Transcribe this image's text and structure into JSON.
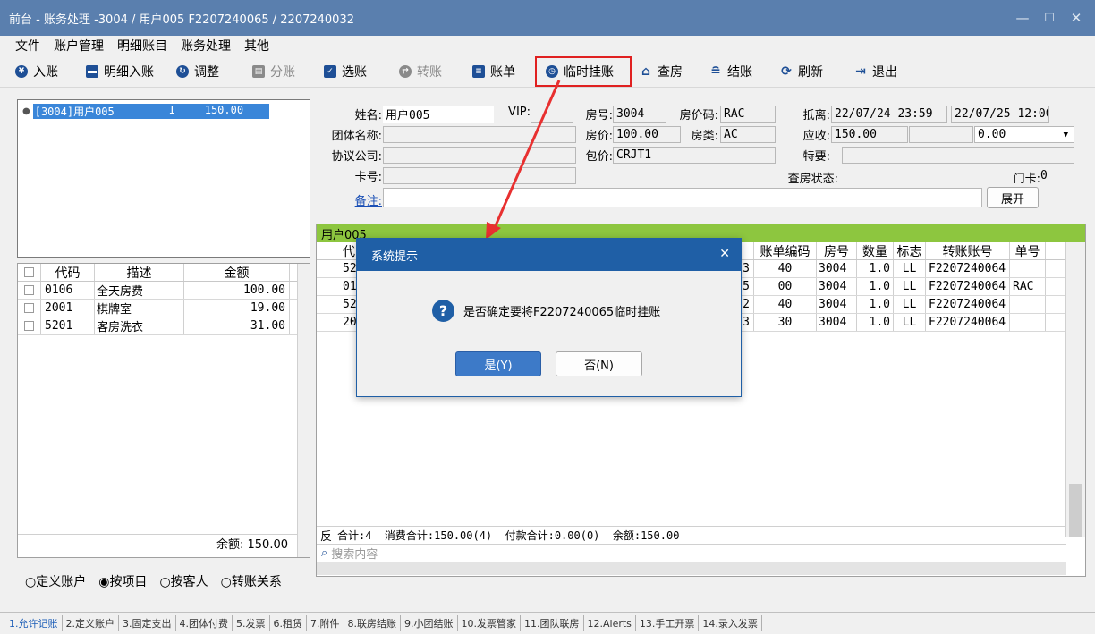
{
  "window": {
    "title": "前台 - 账务处理 -3004 / 用户005 F2207240065 / 2207240032",
    "minimize": "—",
    "maximize": "☐",
    "close": "✕"
  },
  "menu": [
    "文件",
    "账户管理",
    "明细账目",
    "账务处理",
    "其他"
  ],
  "toolbar": [
    {
      "label": "入账",
      "icon": "yen-icon",
      "enabled": true
    },
    {
      "label": "明细入账",
      "icon": "card-icon",
      "enabled": true
    },
    {
      "label": "调整",
      "icon": "adjust-icon",
      "enabled": true
    },
    {
      "label": "分账",
      "icon": "split-icon",
      "enabled": false
    },
    {
      "label": "选账",
      "icon": "select-icon",
      "enabled": true
    },
    {
      "label": "转账",
      "icon": "transfer-icon",
      "enabled": false
    },
    {
      "label": "账单",
      "icon": "bill-icon",
      "enabled": true
    },
    {
      "label": "临时挂账",
      "icon": "clock-icon",
      "enabled": true
    },
    {
      "label": "查房",
      "icon": "house-icon",
      "enabled": true
    },
    {
      "label": "结账",
      "icon": "database-icon",
      "enabled": true
    },
    {
      "label": "刷新",
      "icon": "refresh-icon",
      "enabled": true
    },
    {
      "label": "退出",
      "icon": "exit-icon",
      "enabled": true
    }
  ],
  "account_list": {
    "bullet": "●",
    "items": [
      {
        "room": "[3004]用户005",
        "status": "I",
        "amount": "150.00"
      }
    ]
  },
  "left_grid": {
    "headers": [
      "代码",
      "描述",
      "金额"
    ],
    "rows": [
      [
        "0106",
        "全天房费",
        "100.00"
      ],
      [
        "2001",
        "棋牌室",
        "19.00"
      ],
      [
        "5201",
        "客房洗衣",
        "31.00"
      ]
    ],
    "balance": "余额: 150.00"
  },
  "view_modes": [
    {
      "label": "定义账户",
      "checked": false
    },
    {
      "label": "按项目",
      "checked": true
    },
    {
      "label": "按客人",
      "checked": false
    },
    {
      "label": "转账关系",
      "checked": false
    }
  ],
  "guest": {
    "name_label": "姓名:",
    "name": "用户005",
    "vip_label": "VIP:",
    "vip": "",
    "room_label": "房号:",
    "room": "3004",
    "rate_code_label": "房价码:",
    "rate_code": "RAC",
    "arrival_label": "抵离:",
    "arrival": "22/07/24 23:59",
    "departure": "22/07/25 12:00",
    "group_label": "团体名称:",
    "group": "",
    "rate_label": "房价:",
    "rate": "100.00",
    "room_type_label": "房类:",
    "room_type": "AC",
    "receivable_label": "应收:",
    "receivable": "150.00",
    "receivable_extra": "0.00",
    "company_label": "协议公司:",
    "company": "",
    "package_label": "包价:",
    "package": "CRJT1",
    "special_label": "特要:",
    "special": "",
    "card_label": "卡号:",
    "card": "",
    "inspection_label": "查房状态:",
    "door_card_label": "门卡:",
    "door_card": "0",
    "remark_label": "备注:",
    "remark": "",
    "expand_button": "展开"
  },
  "right_grid": {
    "title": "用户005",
    "headers": [
      "代",
      "账单编码",
      "房号",
      "数量",
      "标志",
      "转账账号",
      "单号"
    ],
    "rows": [
      [
        "52",
        "3",
        "40",
        "3004",
        "1.0",
        "LL",
        "F2207240064",
        ""
      ],
      [
        "01",
        "5",
        "00",
        "3004",
        "1.0",
        "LL",
        "F2207240064",
        "RAC"
      ],
      [
        "52",
        "2",
        "40",
        "3004",
        "1.0",
        "LL",
        "F2207240064",
        ""
      ],
      [
        "20",
        "3",
        "30",
        "3004",
        "1.0",
        "LL",
        "F2207240064",
        ""
      ]
    ],
    "summary_prefix": "反",
    "summary": "合计:4  消费合计:150.00(4)  付款合计:0.00(0)  余额:150.00",
    "search_placeholder": "搜索内容"
  },
  "dialog": {
    "title": "系统提示",
    "close": "✕",
    "message": "是否确定要将F2207240065临时挂账",
    "yes": "是(Y)",
    "no": "否(N)"
  },
  "bottom_tabs": [
    "1.允许记账",
    "2.定义账户",
    "3.固定支出",
    "4.团体付费",
    "5.发票",
    "6.租赁",
    "7.附件",
    "8.联房结账",
    "9.小团结账",
    "10.发票管家",
    "11.团队联房",
    "12.Alerts",
    "13.手工开票",
    "14.录入发票"
  ],
  "colors": {
    "titlebar": "#5a7fae",
    "accent": "#1f5fa6",
    "highlight": "#e02020",
    "grid_header_green": "#8dc63f",
    "selection": "#3a86d9"
  }
}
